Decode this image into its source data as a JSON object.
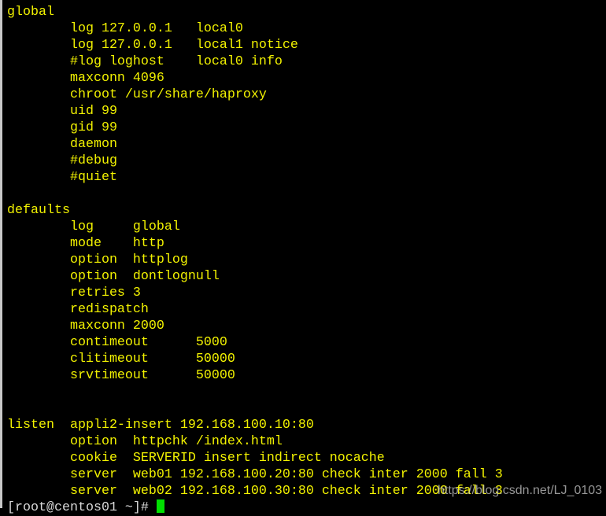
{
  "terminal": {
    "text_color": "#f2f200",
    "background": "#000000",
    "lines": [
      "global",
      "        log 127.0.0.1   local0",
      "        log 127.0.0.1   local1 notice",
      "        #log loghost    local0 info",
      "        maxconn 4096",
      "        chroot /usr/share/haproxy",
      "        uid 99",
      "        gid 99",
      "        daemon",
      "        #debug",
      "        #quiet",
      "",
      "defaults",
      "        log     global",
      "        mode    http",
      "        option  httplog",
      "        option  dontlognull",
      "        retries 3",
      "        redispatch",
      "        maxconn 2000",
      "        contimeout      5000",
      "        clitimeout      50000",
      "        srvtimeout      50000",
      "",
      "",
      "listen  appli2-insert 192.168.100.10:80",
      "        option  httpchk /index.html",
      "        cookie  SERVERID insert indirect nocache",
      "        server  web01 192.168.100.20:80 check inter 2000 fall 3",
      "        server  web02 192.168.100.30:80 check inter 2000 fall 3"
    ],
    "prompt": "[root@centos01 ~]# ",
    "cursor_color": "#00e000"
  },
  "watermark": "https://blog.csdn.net/LJ_0103"
}
